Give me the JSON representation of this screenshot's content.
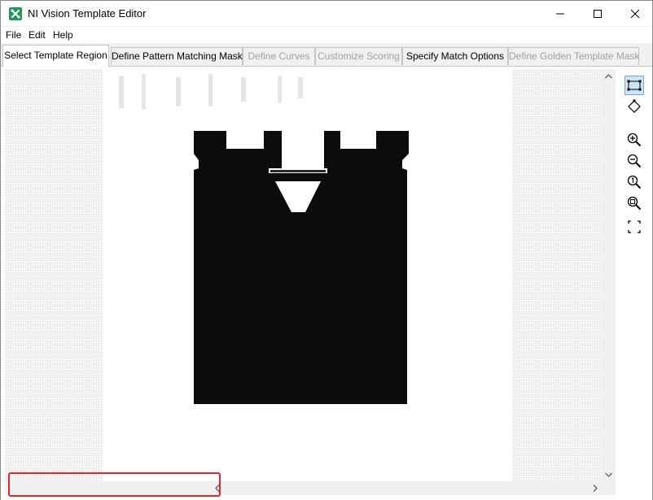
{
  "window": {
    "title": "NI Vision Template Editor",
    "buttons": {
      "minimize": "minimize-icon",
      "maximize": "maximize-icon",
      "close": "close-icon"
    }
  },
  "menu": {
    "items": [
      "File",
      "Edit",
      "Help"
    ]
  },
  "tabs": [
    {
      "label": "Select Template Region",
      "state": "active"
    },
    {
      "label": "Define Pattern Matching Mask",
      "state": "enabled"
    },
    {
      "label": "Define Curves",
      "state": "disabled"
    },
    {
      "label": "Customize Scoring",
      "state": "disabled"
    },
    {
      "label": "Specify Match Options",
      "state": "enabled"
    },
    {
      "label": "Define Golden Template Mask",
      "state": "disabled"
    }
  ],
  "toolbar": {
    "tools": [
      {
        "name": "rectangle-select-icon",
        "selected": true
      },
      {
        "name": "rotated-rectangle-icon",
        "selected": false
      },
      {
        "name": "zoom-in-icon",
        "selected": false
      },
      {
        "name": "zoom-out-icon",
        "selected": false
      },
      {
        "name": "zoom-actual-size-icon",
        "selected": false
      },
      {
        "name": "zoom-fit-icon",
        "selected": false
      },
      {
        "name": "fit-to-window-icon",
        "selected": false
      }
    ]
  },
  "colors": {
    "accent": "#1a9a55",
    "annotation": "#e0262a",
    "selection": "#cce4f7"
  }
}
